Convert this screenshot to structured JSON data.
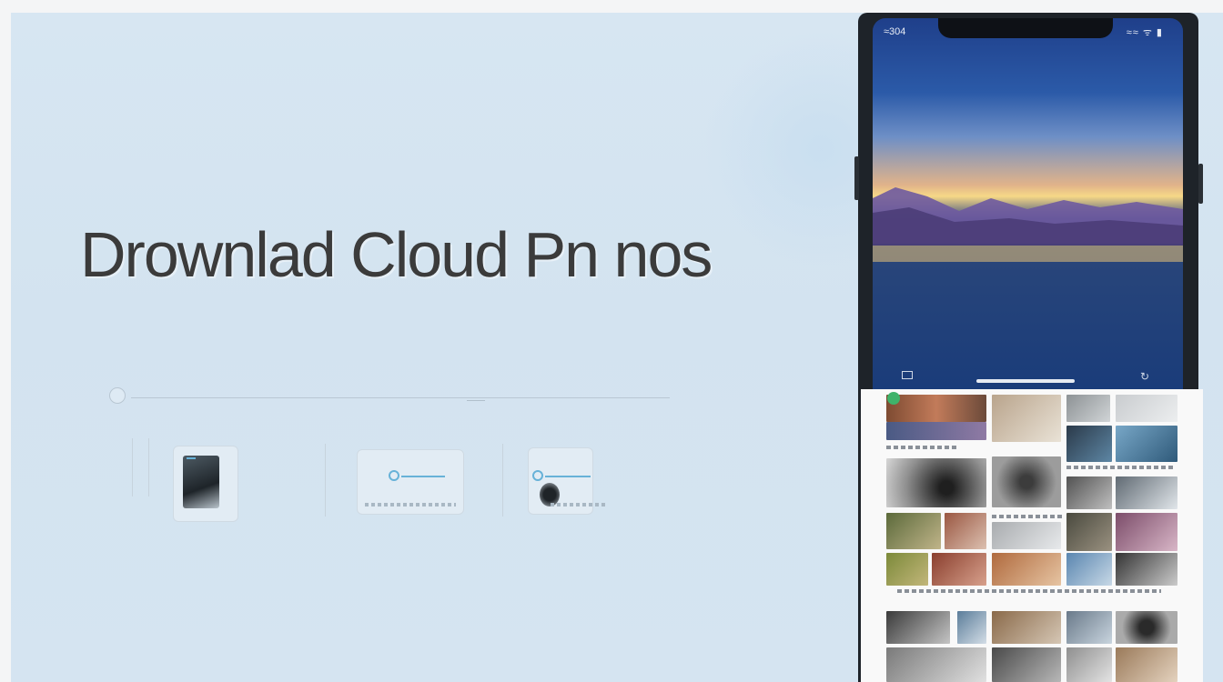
{
  "headline": "Drownlad Cloud Pn nos",
  "phone": {
    "status_time": "≈304",
    "status_icons": "≈≈ ᯤ ▮",
    "wallpaper": "mountain lake at sunset",
    "bottom_left_icon": "□",
    "bottom_right_icon": "↻"
  },
  "colors": {
    "background": "#d5e4f1",
    "headline": "#3b3b3b",
    "accent": "#67b2d8",
    "phone_frame": "#1e2329"
  },
  "icons": [
    "slider-knob-icon",
    "photo-card-icon",
    "sync-card-icon",
    "phone-card-icon",
    "app-icon"
  ]
}
